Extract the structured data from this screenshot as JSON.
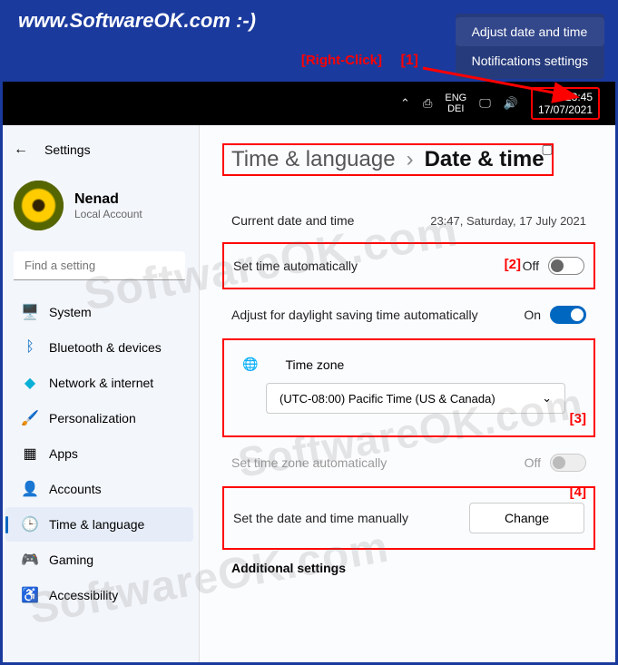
{
  "banner": {
    "site_url": "www.SoftwareOK.com :-)",
    "context_menu": {
      "item1": "Adjust date and time",
      "item2": "Notifications settings"
    },
    "right_click_label": "[Right-Click]",
    "marker_1": "[1]"
  },
  "taskbar": {
    "lang_top": "ENG",
    "lang_bottom": "DEI",
    "time": "23:45",
    "date": "17/07/2021"
  },
  "sidebar": {
    "title": "Settings",
    "user": {
      "name": "Nenad",
      "type": "Local Account"
    },
    "search_placeholder": "Find a setting",
    "items": [
      {
        "label": "System"
      },
      {
        "label": "Bluetooth & devices"
      },
      {
        "label": "Network & internet"
      },
      {
        "label": "Personalization"
      },
      {
        "label": "Apps"
      },
      {
        "label": "Accounts"
      },
      {
        "label": "Time & language"
      },
      {
        "label": "Gaming"
      },
      {
        "label": "Accessibility"
      }
    ]
  },
  "content": {
    "breadcrumb": {
      "parent": "Time & language",
      "sep": "›",
      "current": "Date & time"
    },
    "current_dt": {
      "label": "Current date and time",
      "value": "23:47, Saturday, 17 July 2021"
    },
    "auto_time": {
      "label": "Set time automatically",
      "state": "Off",
      "marker": "[2]"
    },
    "dst": {
      "label": "Adjust for daylight saving time automatically",
      "state": "On"
    },
    "timezone": {
      "label": "Time zone",
      "selected": "(UTC-08:00) Pacific Time (US & Canada)",
      "marker": "[3]"
    },
    "auto_tz": {
      "label": "Set time zone automatically",
      "state": "Off"
    },
    "manual": {
      "label": "Set the date and time manually",
      "button": "Change",
      "marker": "[4]"
    },
    "more_heading": "Additional settings"
  },
  "watermark": "SoftwareOK.com"
}
